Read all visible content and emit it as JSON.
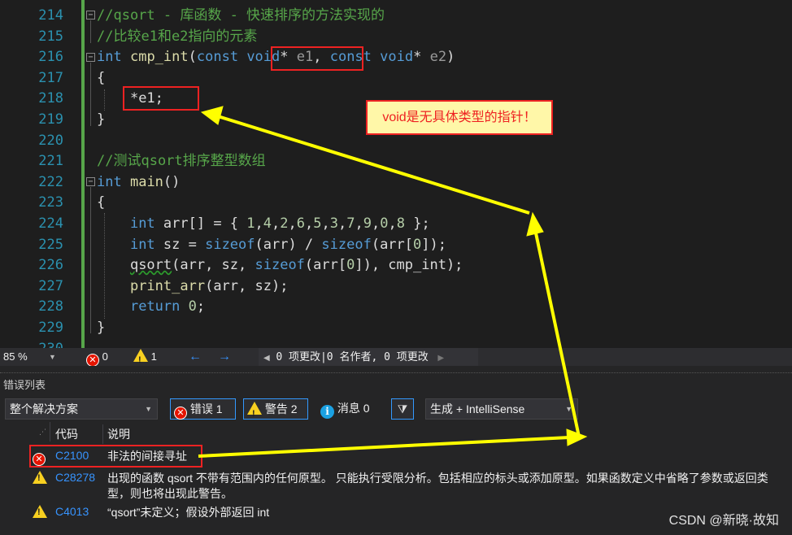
{
  "editor": {
    "lines": [
      {
        "no": "214",
        "tokens": [
          {
            "t": "//qsort - 库函数 - 快速排序的方法实现的",
            "c": "c-cmt"
          }
        ]
      },
      {
        "no": "215",
        "tokens": [
          {
            "t": "//比较e1和e2指向的元素",
            "c": "c-cmt"
          }
        ]
      },
      {
        "no": "216",
        "tokens": [
          {
            "t": "int",
            "c": "c-kw"
          },
          {
            "t": " ",
            "c": "c-id"
          },
          {
            "t": "cmp_int",
            "c": "c-fn"
          },
          {
            "t": "(",
            "c": "c-id"
          },
          {
            "t": "const",
            "c": "c-kw"
          },
          {
            "t": " ",
            "c": "c-id"
          },
          {
            "t": "void",
            "c": "c-kw"
          },
          {
            "t": "* ",
            "c": "c-id"
          },
          {
            "t": "e1",
            "c": "c-par"
          },
          {
            "t": ", ",
            "c": "c-id"
          },
          {
            "t": "const",
            "c": "c-kw"
          },
          {
            "t": " ",
            "c": "c-id"
          },
          {
            "t": "void",
            "c": "c-kw"
          },
          {
            "t": "* ",
            "c": "c-id"
          },
          {
            "t": "e2",
            "c": "c-par"
          },
          {
            "t": ")",
            "c": "c-id"
          }
        ]
      },
      {
        "no": "217",
        "tokens": [
          {
            "t": "{",
            "c": "c-id"
          }
        ]
      },
      {
        "no": "218",
        "tokens": [
          {
            "t": "    ",
            "c": "c-id"
          },
          {
            "t": "*e1;",
            "c": "c-id"
          }
        ]
      },
      {
        "no": "219",
        "tokens": [
          {
            "t": "}",
            "c": "c-id"
          }
        ]
      },
      {
        "no": "220",
        "tokens": []
      },
      {
        "no": "221",
        "tokens": [
          {
            "t": "//测试qsort排序整型数组",
            "c": "c-cmt"
          }
        ]
      },
      {
        "no": "222",
        "tokens": [
          {
            "t": "int",
            "c": "c-kw"
          },
          {
            "t": " ",
            "c": "c-id"
          },
          {
            "t": "main",
            "c": "c-fn"
          },
          {
            "t": "()",
            "c": "c-id"
          }
        ]
      },
      {
        "no": "223",
        "tokens": [
          {
            "t": "{",
            "c": "c-id"
          }
        ]
      },
      {
        "no": "224",
        "tokens": [
          {
            "t": "    ",
            "c": "c-id"
          },
          {
            "t": "int",
            "c": "c-kw"
          },
          {
            "t": " arr[] = { ",
            "c": "c-id"
          },
          {
            "t": "1",
            "c": "c-num"
          },
          {
            "t": ",",
            "c": "c-id"
          },
          {
            "t": "4",
            "c": "c-num"
          },
          {
            "t": ",",
            "c": "c-id"
          },
          {
            "t": "2",
            "c": "c-num"
          },
          {
            "t": ",",
            "c": "c-id"
          },
          {
            "t": "6",
            "c": "c-num"
          },
          {
            "t": ",",
            "c": "c-id"
          },
          {
            "t": "5",
            "c": "c-num"
          },
          {
            "t": ",",
            "c": "c-id"
          },
          {
            "t": "3",
            "c": "c-num"
          },
          {
            "t": ",",
            "c": "c-id"
          },
          {
            "t": "7",
            "c": "c-num"
          },
          {
            "t": ",",
            "c": "c-id"
          },
          {
            "t": "9",
            "c": "c-num"
          },
          {
            "t": ",",
            "c": "c-id"
          },
          {
            "t": "0",
            "c": "c-num"
          },
          {
            "t": ",",
            "c": "c-id"
          },
          {
            "t": "8",
            "c": "c-num"
          },
          {
            "t": " };",
            "c": "c-id"
          }
        ]
      },
      {
        "no": "225",
        "tokens": [
          {
            "t": "    ",
            "c": "c-id"
          },
          {
            "t": "int",
            "c": "c-kw"
          },
          {
            "t": " sz = ",
            "c": "c-id"
          },
          {
            "t": "sizeof",
            "c": "c-kw"
          },
          {
            "t": "(arr) / ",
            "c": "c-id"
          },
          {
            "t": "sizeof",
            "c": "c-kw"
          },
          {
            "t": "(arr[",
            "c": "c-id"
          },
          {
            "t": "0",
            "c": "c-num"
          },
          {
            "t": "]);",
            "c": "c-id"
          }
        ]
      },
      {
        "no": "226",
        "tokens": [
          {
            "t": "    ",
            "c": "c-id"
          },
          {
            "t": "qsort",
            "c": "c-id squig"
          },
          {
            "t": "(arr, sz, ",
            "c": "c-id"
          },
          {
            "t": "sizeof",
            "c": "c-kw"
          },
          {
            "t": "(arr[",
            "c": "c-id"
          },
          {
            "t": "0",
            "c": "c-num"
          },
          {
            "t": "]), cmp_int);",
            "c": "c-id"
          }
        ]
      },
      {
        "no": "227",
        "tokens": [
          {
            "t": "    ",
            "c": "c-id"
          },
          {
            "t": "print_arr",
            "c": "c-fn"
          },
          {
            "t": "(arr, sz);",
            "c": "c-id"
          }
        ]
      },
      {
        "no": "228",
        "tokens": [
          {
            "t": "    ",
            "c": "c-id"
          },
          {
            "t": "return",
            "c": "c-kw"
          },
          {
            "t": " ",
            "c": "c-id"
          },
          {
            "t": "0",
            "c": "c-num"
          },
          {
            "t": ";",
            "c": "c-id"
          }
        ]
      },
      {
        "no": "229",
        "tokens": [
          {
            "t": "}",
            "c": "c-id"
          }
        ]
      },
      {
        "no": "230",
        "tokens": []
      }
    ],
    "callout": "void是无具体类型的指针！"
  },
  "statusbar": {
    "zoom": "85 %",
    "errors": "0",
    "warnings": "1",
    "changes": "0 项更改|0 名作者, 0 项更改"
  },
  "error_list": {
    "title": "错误列表",
    "scope": "整个解决方案",
    "errors_btn": "错误 1",
    "warnings_btn": "警告 2",
    "messages_btn": "消息 0",
    "source": "生成 + IntelliSense",
    "col_code": "代码",
    "col_desc": "说明",
    "rows": [
      {
        "kind": "error",
        "code": "C2100",
        "desc": "非法的间接寻址"
      },
      {
        "kind": "warning",
        "code": "C28278",
        "desc": "出现的函数 qsort 不带有范围内的任何原型。 只能执行受限分析。包括相应的标头或添加原型。如果函数定义中省略了参数或返回类型，则也将出现此警告。"
      },
      {
        "kind": "warning",
        "code": "C4013",
        "desc": "“qsort”未定义；假设外部返回 int"
      }
    ]
  },
  "watermark": "CSDN @新晓·故知",
  "colors": {
    "accent": "#3399ff",
    "error": "#e51400",
    "warning": "#f8d020",
    "annotation": "#ee2222",
    "arrow": "#ffff00"
  }
}
